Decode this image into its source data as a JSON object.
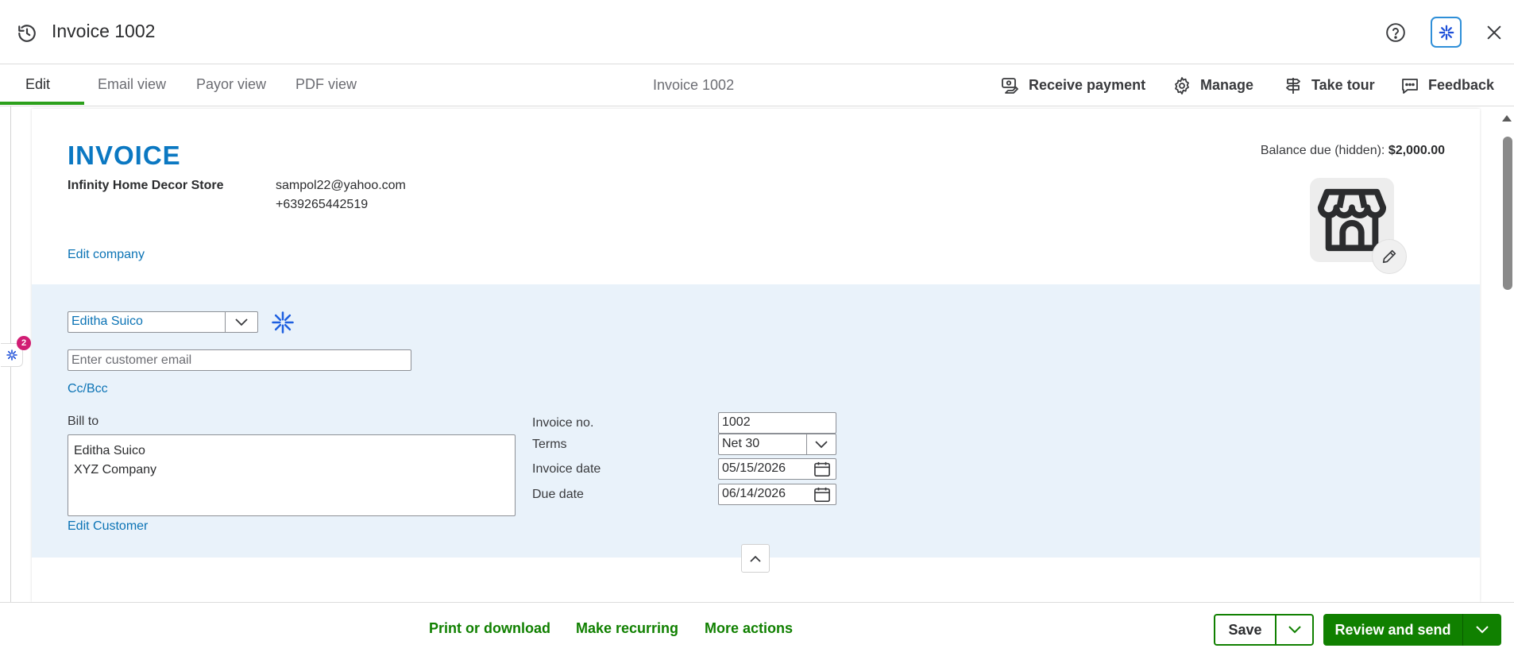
{
  "window": {
    "title": "Invoice 1002",
    "icons": {
      "history": "history-icon",
      "help": "help-icon",
      "ai": "ai-assistant-icon",
      "close": "close-icon"
    }
  },
  "tabs": {
    "items": [
      {
        "label": "Edit",
        "active": true
      },
      {
        "label": "Email view",
        "active": false
      },
      {
        "label": "Payor view",
        "active": false
      },
      {
        "label": "PDF view",
        "active": false
      }
    ],
    "center_title": "Invoice 1002",
    "actions": [
      {
        "label": "Receive payment",
        "icon": "receive-payment-icon"
      },
      {
        "label": "Manage",
        "icon": "gear-icon"
      },
      {
        "label": "Take tour",
        "icon": "signpost-icon"
      },
      {
        "label": "Feedback",
        "icon": "feedback-icon"
      }
    ],
    "accent": "#2ca01c"
  },
  "sidebar": {
    "badge_count": "2"
  },
  "invoice": {
    "heading": "INVOICE",
    "company": {
      "name": "Infinity Home Decor Store",
      "email": "sampol22@yahoo.com",
      "phone": "+639265442519",
      "edit_label": "Edit company"
    },
    "balance": {
      "label": "Balance due (hidden): ",
      "amount": "$2,000.00"
    },
    "logo_icon": "storefront-icon",
    "customer": {
      "selected": "Editha Suico",
      "email_placeholder": "Enter customer email",
      "email_value": "",
      "cc_bcc_label": "Cc/Bcc",
      "bill_to_label": "Bill to",
      "bill_to_lines": [
        "Editha Suico",
        "XYZ Company"
      ],
      "edit_label": "Edit Customer"
    },
    "fields": {
      "invoice_no": {
        "label": "Invoice no.",
        "value": "1002"
      },
      "terms": {
        "label": "Terms",
        "value": "Net 30"
      },
      "invoice_date": {
        "label": "Invoice date",
        "value": "05/15/2026"
      },
      "due_date": {
        "label": "Due date",
        "value": "06/14/2026"
      }
    },
    "colors": {
      "heading": "#0b78c2",
      "link": "#0b73b5",
      "band": "#e9f2fa"
    }
  },
  "footer": {
    "links": [
      "Print or download",
      "Make recurring",
      "More actions"
    ],
    "save_label": "Save",
    "review_send_label": "Review and send",
    "primary_color": "#108000"
  }
}
